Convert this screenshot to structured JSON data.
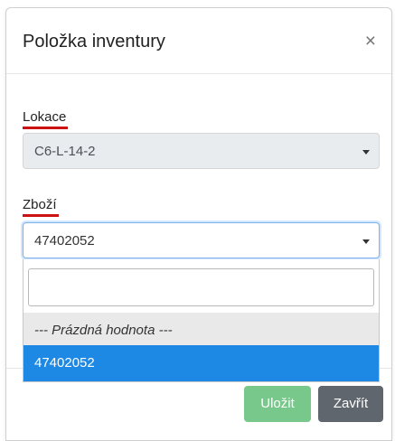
{
  "modal": {
    "title": "Položka inventury",
    "close_symbol": "×"
  },
  "fields": {
    "location": {
      "label": "Lokace",
      "value": "C6-L-14-2",
      "disabled": true
    },
    "goods": {
      "label": "Zboží",
      "value": "47402052",
      "search_value": "",
      "options": [
        {
          "label": "--- Prázdná hodnota ---",
          "state": "hover"
        },
        {
          "label": "47402052",
          "state": "selected"
        }
      ]
    }
  },
  "footer": {
    "save_label": "Uložit",
    "close_label": "Zavřít"
  },
  "colors": {
    "label_underline": "#cc1111",
    "selected_option": "#1e88e5",
    "save_button": "#78c78b",
    "close_button": "#5f666d"
  },
  "icons": {
    "close": "close-icon",
    "dropdown": "chevron-down-icon"
  }
}
